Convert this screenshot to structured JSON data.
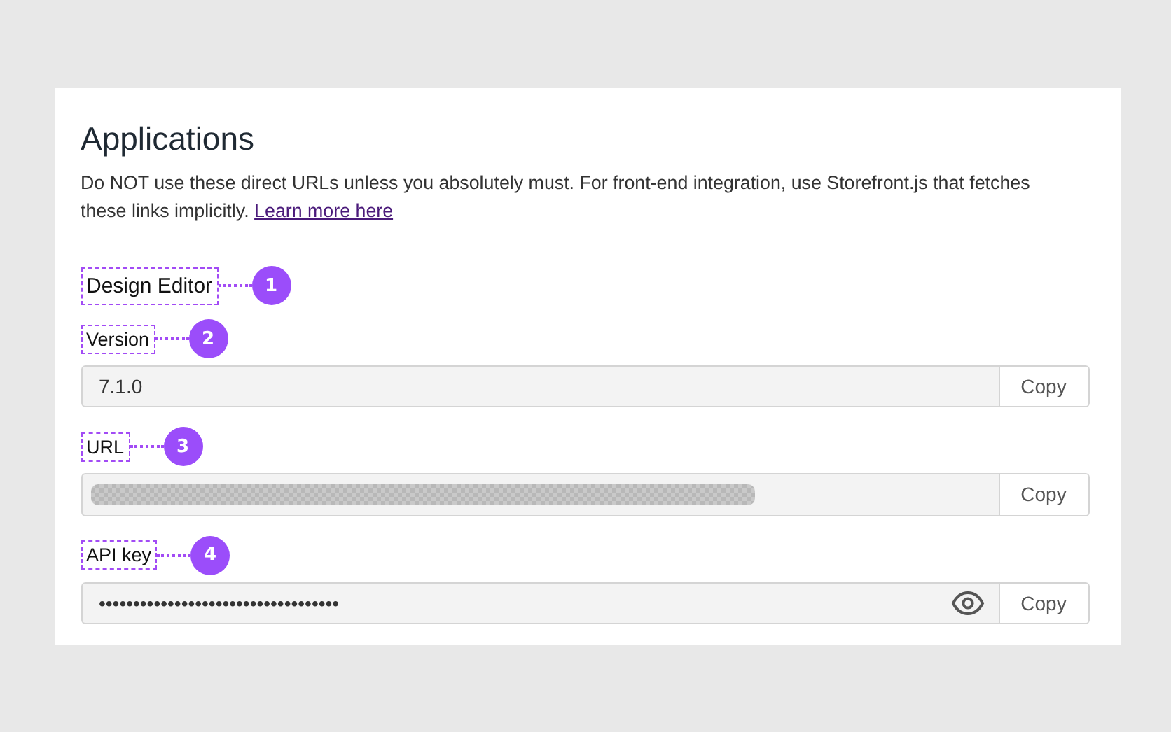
{
  "title": "Applications",
  "description": "Do NOT use these direct URLs unless you absolutely must. For front-end integration, use Storefront.js that fetches these links implicitly.",
  "link": "Learn more here",
  "section": {
    "label": "Design Editor",
    "marker": "1"
  },
  "fields": [
    {
      "label": "Version",
      "marker": "2",
      "kind": "text",
      "value": "7.1.0",
      "button": "Copy"
    },
    {
      "label": "URL",
      "marker": "3",
      "kind": "blurred",
      "button": "Copy"
    },
    {
      "label": "API key",
      "marker": "4",
      "kind": "secret",
      "value": "•••••••••••••••••••••••••••••••••••",
      "button": "Copy"
    }
  ]
}
